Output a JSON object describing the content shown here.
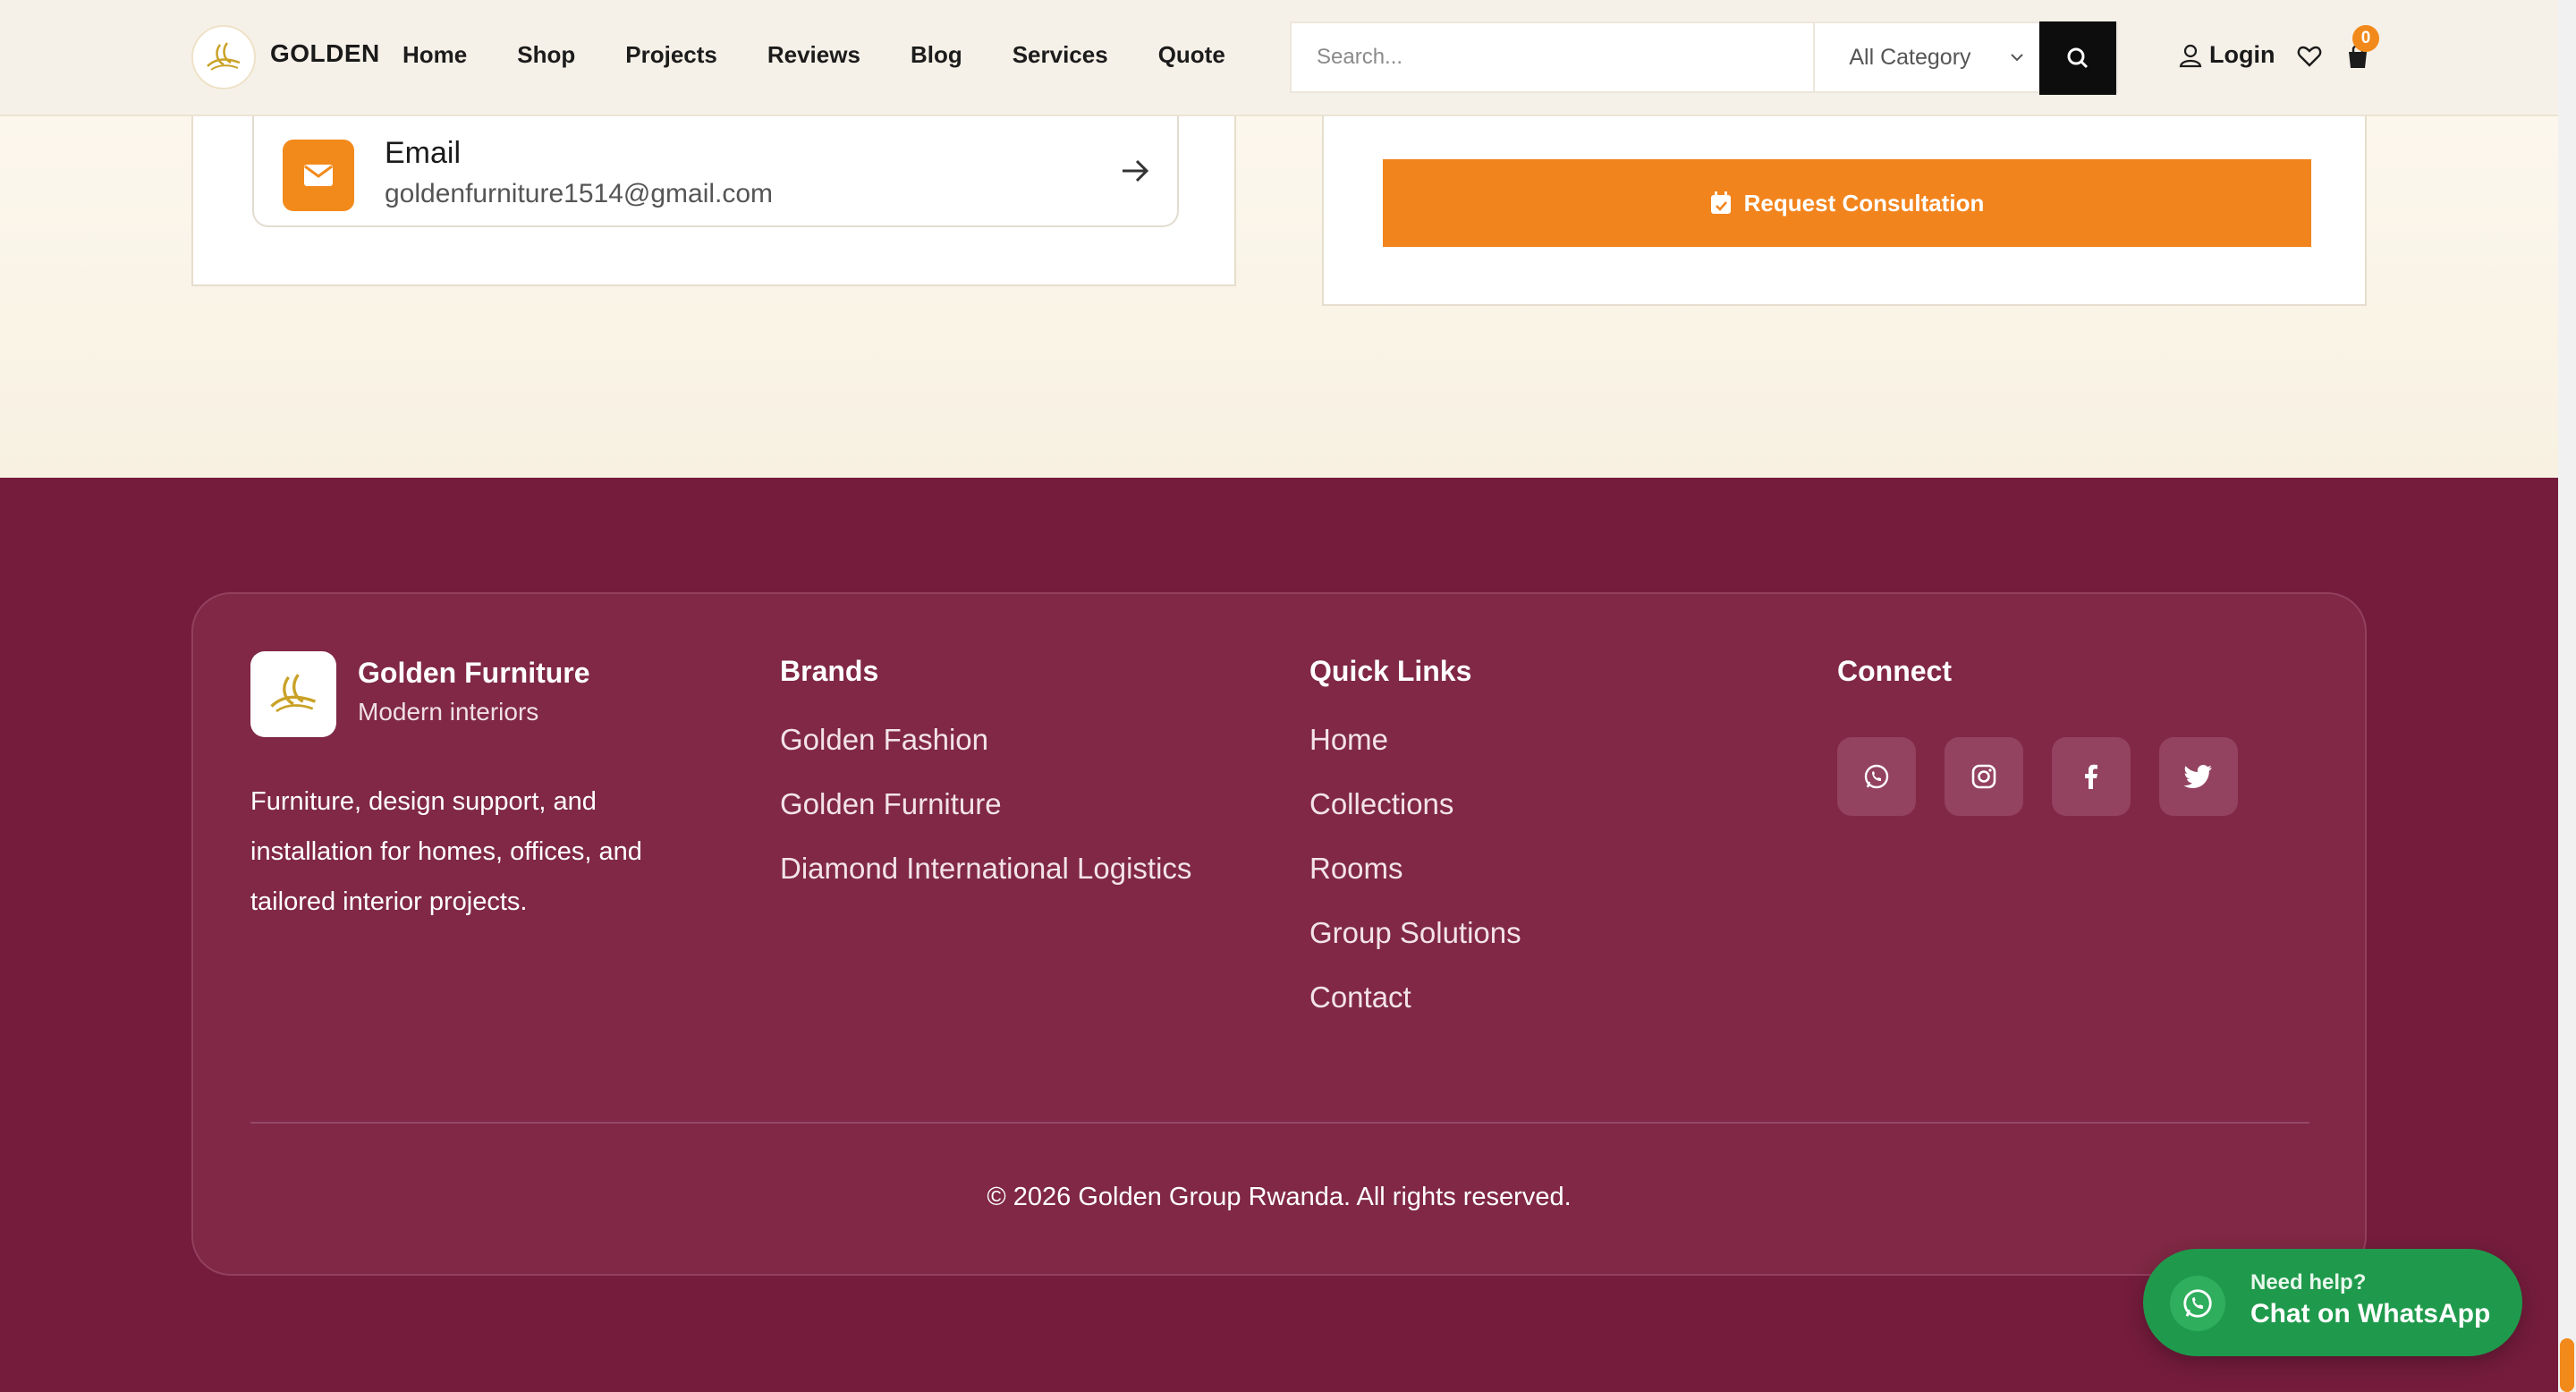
{
  "header": {
    "brand": "GOLDEN",
    "nav": [
      "Home",
      "Shop",
      "Projects",
      "Reviews",
      "Blog",
      "Services",
      "Quote"
    ],
    "search_placeholder": "Search...",
    "category_selected": "All Category",
    "login_label": "Login",
    "cart_count": "0"
  },
  "contact": {
    "email_title": "Email",
    "email_address": "goldenfurniture1514@gmail.com"
  },
  "consultation": {
    "button_label": "Request Consultation"
  },
  "footer": {
    "brand_name": "Golden Furniture",
    "brand_sub": "Modern interiors",
    "description": "Furniture, design support, and installation for homes, offices, and tailored interior projects.",
    "brands_title": "Brands",
    "brands": [
      "Golden Fashion",
      "Golden Furniture",
      "Diamond International Logistics"
    ],
    "quick_title": "Quick Links",
    "quick_links": [
      "Home",
      "Collections",
      "Rooms",
      "Group Solutions",
      "Contact"
    ],
    "connect_title": "Connect",
    "socials": [
      "whatsapp-icon",
      "instagram-icon",
      "facebook-icon",
      "twitter-icon"
    ],
    "copyright": "© 2026 Golden Group Rwanda. All rights reserved."
  },
  "whatsapp_float": {
    "help": "Need help?",
    "chat": "Chat on WhatsApp"
  },
  "colors": {
    "accent": "#f2841d",
    "footer_bg": "#751c3c",
    "whatsapp": "#1f9a4c"
  }
}
